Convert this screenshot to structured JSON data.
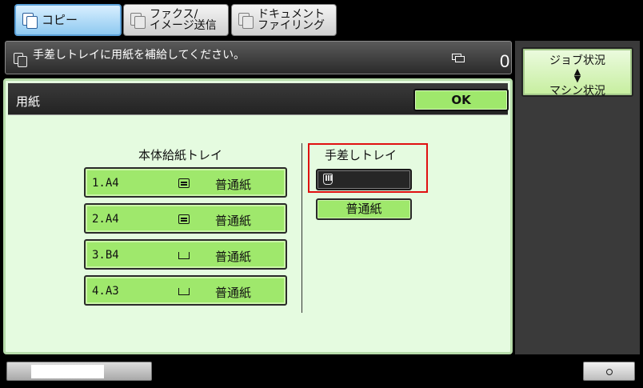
{
  "tabs": [
    {
      "label": "コピー",
      "active": true,
      "icon": "copy-icon"
    },
    {
      "label": "ファクス/\nイメージ送信",
      "active": false,
      "icon": "fax-icon"
    },
    {
      "label": "ドキュメント\nファイリング",
      "active": false,
      "icon": "document-filing-icon"
    }
  ],
  "message_bar": {
    "message": "手差しトレイに用紙を補給してください。",
    "copy_count": "0"
  },
  "status_panel": {
    "job_status_label": "ジョブ状況",
    "machine_status_label": "マシン状況"
  },
  "dialog": {
    "title": "用紙",
    "ok_label": "OK",
    "main_trays_label": "本体給紙トレイ",
    "main_trays": [
      {
        "number": "1.A4",
        "paper_type": "普通紙",
        "tray_state": "loaded"
      },
      {
        "number": "2.A4",
        "paper_type": "普通紙",
        "tray_state": "loaded"
      },
      {
        "number": "3.B4",
        "paper_type": "普通紙",
        "tray_state": "empty"
      },
      {
        "number": "4.A3",
        "paper_type": "普通紙",
        "tray_state": "empty"
      }
    ],
    "bypass_tray_label": "手差しトレイ",
    "bypass_paper_type": "普通紙"
  },
  "colors": {
    "button_green": "#9fe86c",
    "dialog_bg": "#e5fbe0",
    "highlight_red": "#e01010",
    "active_tab": "#8fc9f0"
  },
  "progress_fraction": 0.66
}
